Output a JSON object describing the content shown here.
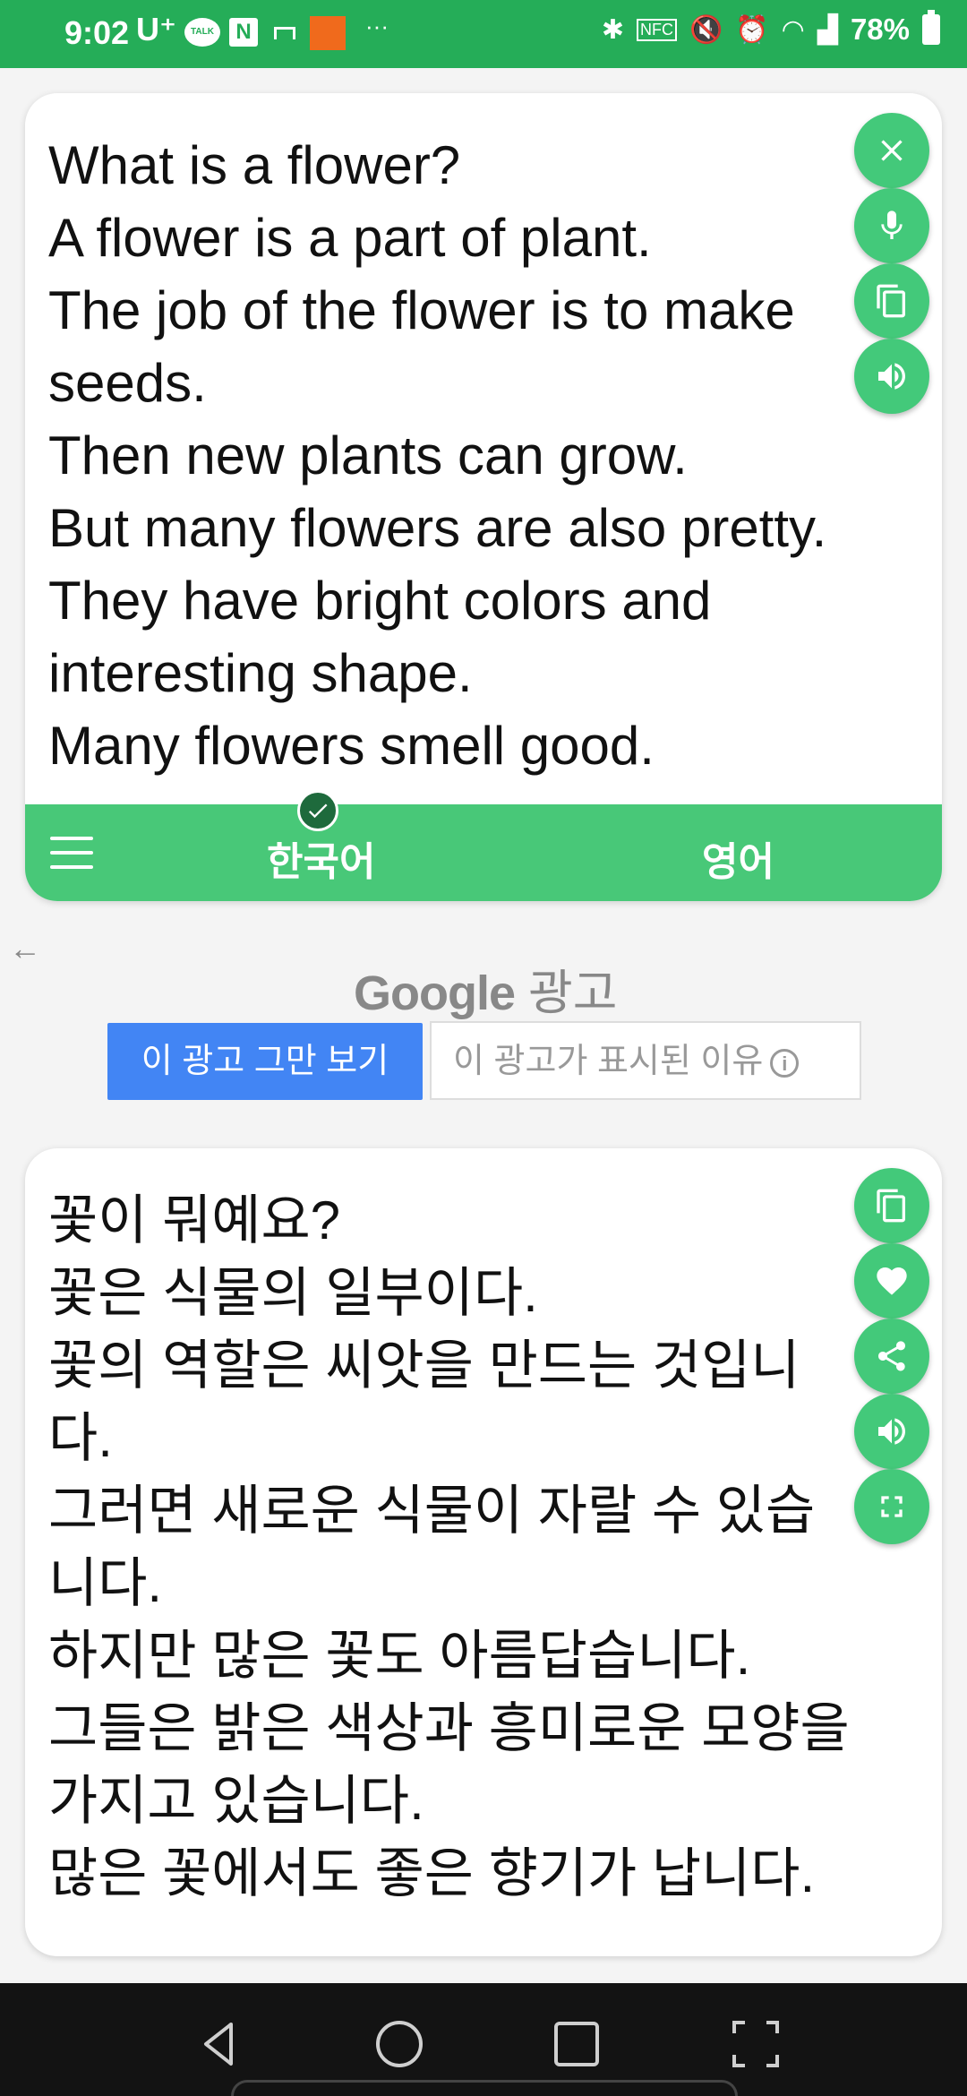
{
  "status_bar": {
    "time": "9:02",
    "carrier": "U⁺",
    "talk_icon_text": "TALK",
    "n_icon_text": "N",
    "more": "···",
    "battery": "78%"
  },
  "source": {
    "text": "What is a flower?\nA flower is a part of plant.\nThe job of the flower is to make seeds.\nThen new plants can grow.\nBut many flowers are also pretty.\nThey have bright colors and interesting shape.\nMany flowers smell good.",
    "actions": [
      "close-icon",
      "mic-icon",
      "copy-icon",
      "volume-icon"
    ]
  },
  "lang_bar": {
    "source_lang": "한국어",
    "target_lang": "영어"
  },
  "ad": {
    "label_google": "Google",
    "label_ad": "광고",
    "stop_button": "이 광고 그만 보기",
    "why_button": "이 광고가 표시된 이유"
  },
  "target": {
    "text": "꽃이 뭐예요?\n꽃은 식물의 일부이다.\n꽃의 역할은 씨앗을 만드는 것입니다.\n그러면 새로운 식물이 자랄 수 있습니다.\n하지만 많은 꽃도 아름답습니다.\n그들은 밝은 색상과 흥미로운 모양을 가지고 있습니다.\n많은 꽃에서도 좋은 향기가 납니다.",
    "actions": [
      "copy-icon",
      "heart-icon",
      "share-icon",
      "volume-icon",
      "fullscreen-icon"
    ]
  },
  "colors": {
    "status_bar": "#25ad58",
    "fab": "#43c97a",
    "lang_bar": "#48c878",
    "ad_stop": "#4285f4"
  }
}
